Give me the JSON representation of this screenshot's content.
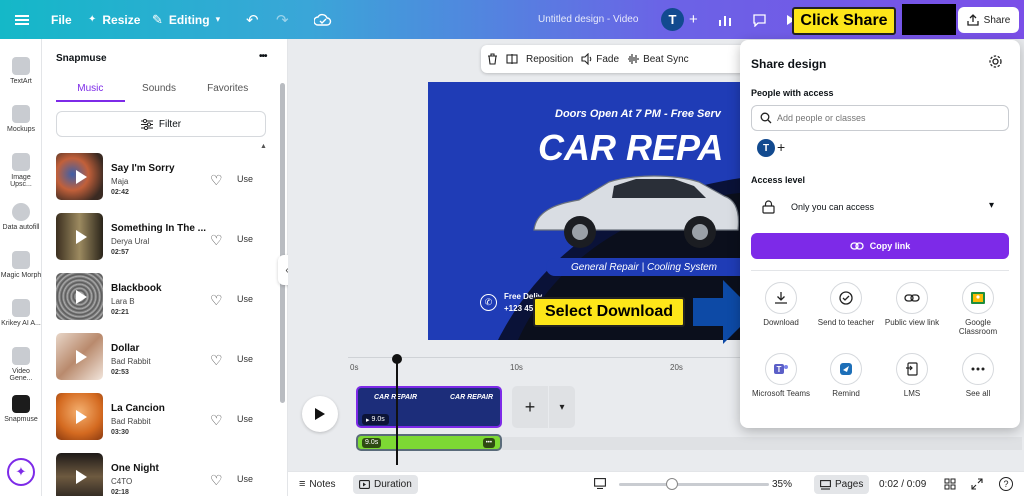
{
  "topbar": {
    "file": "File",
    "resize": "Resize",
    "editing": "Editing",
    "doc_title": "Untitled design - Video",
    "avatar": "T",
    "share": "Share"
  },
  "callouts": {
    "share": "Click Share",
    "download": "Select Download"
  },
  "leftnav": {
    "items": [
      "TextArt",
      "Mockups",
      "Image Upsc...",
      "Data autofill",
      "Magic Morph",
      "Krikey AI A...",
      "Video Gene...",
      "Snapmuse"
    ]
  },
  "panel": {
    "title": "Snapmuse",
    "more": "•••",
    "tabs": [
      "Music",
      "Sounds",
      "Favorites"
    ],
    "filter": "Filter",
    "use_label": "Use",
    "tracks": [
      {
        "name": "Say I'm Sorry",
        "artist": "Maja",
        "duration": "02:42"
      },
      {
        "name": "Something In The ...",
        "artist": "Derya Ural",
        "duration": "02:57"
      },
      {
        "name": "Blackbook",
        "artist": "Lara B",
        "duration": "02:21"
      },
      {
        "name": "Dollar",
        "artist": "Bad Rabbit",
        "duration": "02:53"
      },
      {
        "name": "La Cancion",
        "artist": "Bad Rabbit",
        "duration": "03:30"
      },
      {
        "name": "One Night",
        "artist": "C4TO",
        "duration": "02:18"
      }
    ]
  },
  "context_toolbar": {
    "reposition": "Reposition",
    "fade": "Fade",
    "beat_sync": "Beat Sync"
  },
  "design": {
    "top_text": "Doors Open At 7 PM - Free Serv",
    "headline": "CAR REPA",
    "tagline": "General Repair | Cooling System",
    "free_delivery": "Free Deliv...",
    "phone": "+123 45",
    "thumb_title": "CAR REPAIR"
  },
  "timeline": {
    "ticks": [
      "0s",
      "10s",
      "20s"
    ],
    "clip_duration": "9.0s",
    "audio_duration": "9.0s",
    "audio_more": "•••"
  },
  "bottombar": {
    "notes": "Notes",
    "duration": "Duration",
    "zoom": "35%",
    "zoom_level": 0.35,
    "pages": "Pages",
    "time": "0:02 / 0:09"
  },
  "share": {
    "title": "Share design",
    "people_label": "People with access",
    "search_placeholder": "Add people or classes",
    "avatar": "T",
    "access_label": "Access level",
    "access_value": "Only you can access",
    "copy_link": "Copy link",
    "options": [
      {
        "label": "Download",
        "icon": "download-icon"
      },
      {
        "label": "Send to teacher",
        "icon": "check-circle-icon"
      },
      {
        "label": "Public view link",
        "icon": "link-icon"
      },
      {
        "label": "Google Classroom",
        "icon": "google-classroom-icon"
      },
      {
        "label": "Microsoft Teams",
        "icon": "microsoft-teams-icon"
      },
      {
        "label": "Remind",
        "icon": "remind-icon"
      },
      {
        "label": "LMS",
        "icon": "lms-icon"
      },
      {
        "label": "See all",
        "icon": "more-icon"
      }
    ]
  },
  "colors": {
    "accent": "#7d2ae8",
    "timeline_audio": "#7dd934",
    "callout": "#fde619",
    "arrow": "#0d4aa6"
  }
}
